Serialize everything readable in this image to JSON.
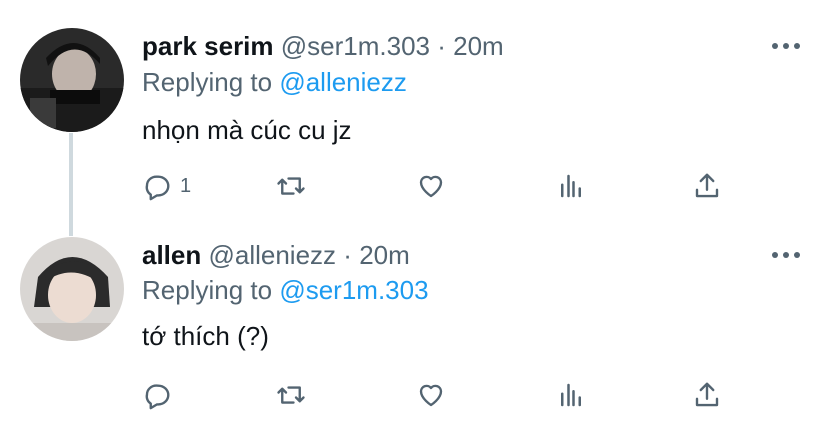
{
  "tweets": [
    {
      "name": "park serim",
      "handle": "@ser1m.303",
      "separator": "·",
      "time": "20m",
      "replying_prefix": "Replying to",
      "replying_to": "@alleniezz",
      "text": "nhọn mà cúc cu jz",
      "reply_count": "1",
      "icons": [
        "reply-icon",
        "retweet-icon",
        "like-icon",
        "analytics-icon",
        "share-icon",
        "more-icon"
      ]
    },
    {
      "name": "allen",
      "handle": "@alleniezz",
      "separator": "·",
      "time": "20m",
      "replying_prefix": "Replying to",
      "replying_to": "@ser1m.303",
      "text": "tớ thích (?)",
      "reply_count": "",
      "icons": [
        "reply-icon",
        "retweet-icon",
        "like-icon",
        "analytics-icon",
        "share-icon",
        "more-icon"
      ]
    }
  ],
  "colors": {
    "text": "#0f1419",
    "secondary": "#536471",
    "mention": "#1d9bf0",
    "thread_line": "#cfd9de"
  }
}
